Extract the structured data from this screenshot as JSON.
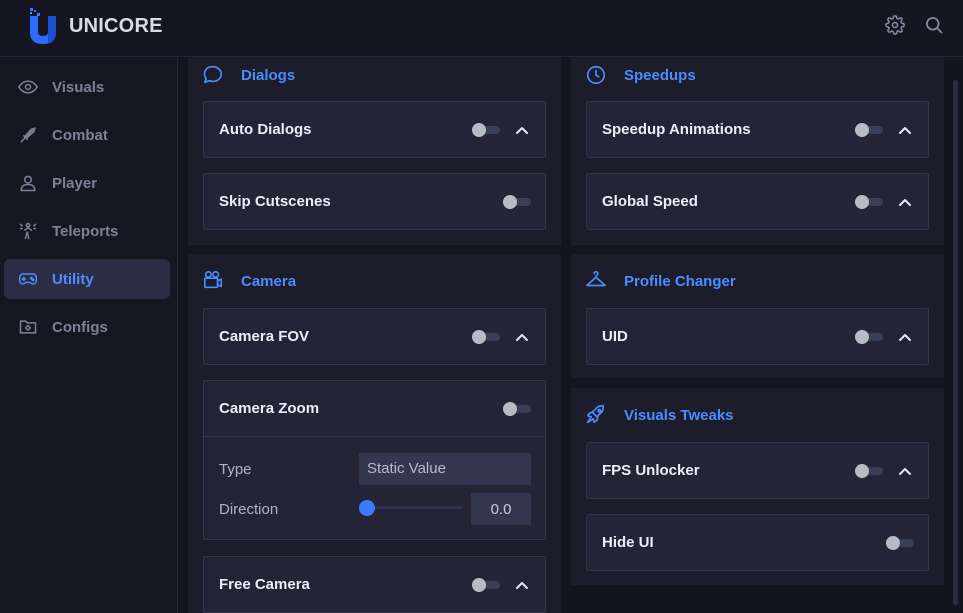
{
  "app": {
    "name": "UNICORE"
  },
  "header": {
    "settings_icon": "gear-icon",
    "search_icon": "search-icon"
  },
  "sidebar": {
    "items": [
      {
        "label": "Visuals",
        "icon": "eye-icon",
        "active": false
      },
      {
        "label": "Combat",
        "icon": "sword-icon",
        "active": false
      },
      {
        "label": "Player",
        "icon": "user-icon",
        "active": false
      },
      {
        "label": "Teleports",
        "icon": "teleport-icon",
        "active": false
      },
      {
        "label": "Utility",
        "icon": "gamepad-icon",
        "active": true
      },
      {
        "label": "Configs",
        "icon": "folder-gear-icon",
        "active": false
      }
    ]
  },
  "panels": {
    "dialogs": {
      "title": "Dialogs",
      "icon": "chat-bubble-icon",
      "items": [
        {
          "label": "Auto Dialogs",
          "enabled": false,
          "expandable": true
        },
        {
          "label": "Skip Cutscenes",
          "enabled": false,
          "expandable": false
        }
      ]
    },
    "camera": {
      "title": "Camera",
      "icon": "camera-icon",
      "items": [
        {
          "label": "Camera FOV",
          "enabled": false,
          "expandable": true
        },
        {
          "label": "Camera Zoom",
          "enabled": false,
          "expandable": false
        },
        {
          "label": "Free Camera",
          "enabled": false,
          "expandable": true
        }
      ],
      "zoom_options": {
        "type_label": "Type",
        "type_value": "Static Value",
        "direction_label": "Direction",
        "direction_value": "0.0",
        "direction_fraction": 0
      }
    },
    "speedups": {
      "title": "Speedups",
      "icon": "clock-icon",
      "items": [
        {
          "label": "Speedup Animations",
          "enabled": false,
          "expandable": true
        },
        {
          "label": "Global Speed",
          "enabled": false,
          "expandable": true
        }
      ]
    },
    "profile_changer": {
      "title": "Profile Changer",
      "icon": "hanger-icon",
      "items": [
        {
          "label": "UID",
          "enabled": false,
          "expandable": true
        }
      ]
    },
    "visuals_tweaks": {
      "title": "Visuals Tweaks",
      "icon": "rocket-icon",
      "items": [
        {
          "label": "FPS Unlocker",
          "enabled": false,
          "expandable": true
        },
        {
          "label": "Hide UI",
          "enabled": false,
          "expandable": false
        }
      ]
    }
  },
  "colors": {
    "accent": "#4a8dff",
    "background": "#14141f",
    "panel": "#1c1c2b",
    "card": "#242436",
    "text": "#eceef5",
    "muted": "#7d8196"
  }
}
